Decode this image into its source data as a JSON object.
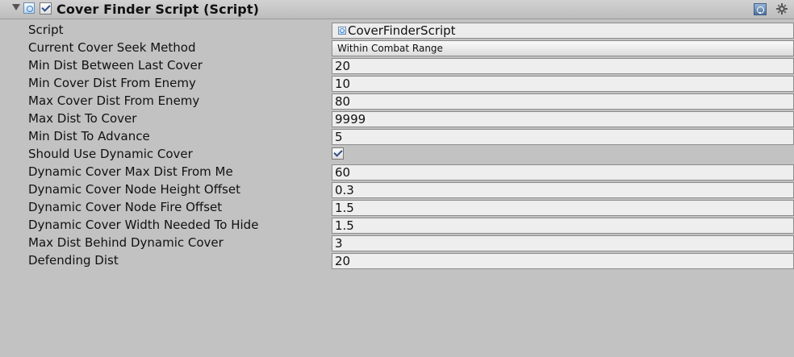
{
  "component": {
    "title": "Cover Finder Script (Script)",
    "enabled": true,
    "icons": {
      "foldout": "foldout-arrow-icon",
      "script": "script-icon",
      "help": "help-icon",
      "settings": "gear-icon"
    }
  },
  "properties": [
    {
      "label": "Script",
      "value": "CoverFinderScript",
      "type": "object"
    },
    {
      "label": "Current Cover Seek Method",
      "value": "Within Combat Range",
      "type": "dropdown"
    },
    {
      "label": "Min Dist Between Last Cover",
      "value": "20",
      "type": "text"
    },
    {
      "label": "Min Cover Dist From Enemy",
      "value": "10",
      "type": "text"
    },
    {
      "label": "Max Cover Dist From Enemy",
      "value": "80",
      "type": "text"
    },
    {
      "label": "Max Dist To Cover",
      "value": "9999",
      "type": "text"
    },
    {
      "label": "Min Dist To Advance",
      "value": "5",
      "type": "text"
    },
    {
      "label": "Should Use Dynamic Cover",
      "value": true,
      "type": "checkbox"
    },
    {
      "label": "Dynamic Cover Max Dist From Me",
      "value": "60",
      "type": "text"
    },
    {
      "label": "Dynamic Cover Node Height Offset",
      "value": "0.3",
      "type": "text"
    },
    {
      "label": "Dynamic Cover Node Fire Offset",
      "value": "1.5",
      "type": "text"
    },
    {
      "label": "Dynamic Cover Width Needed To Hide",
      "value": "1.5",
      "type": "text"
    },
    {
      "label": "Max Dist Behind Dynamic Cover",
      "value": "3",
      "type": "text"
    },
    {
      "label": "Defending Dist",
      "value": "20",
      "type": "text"
    }
  ]
}
